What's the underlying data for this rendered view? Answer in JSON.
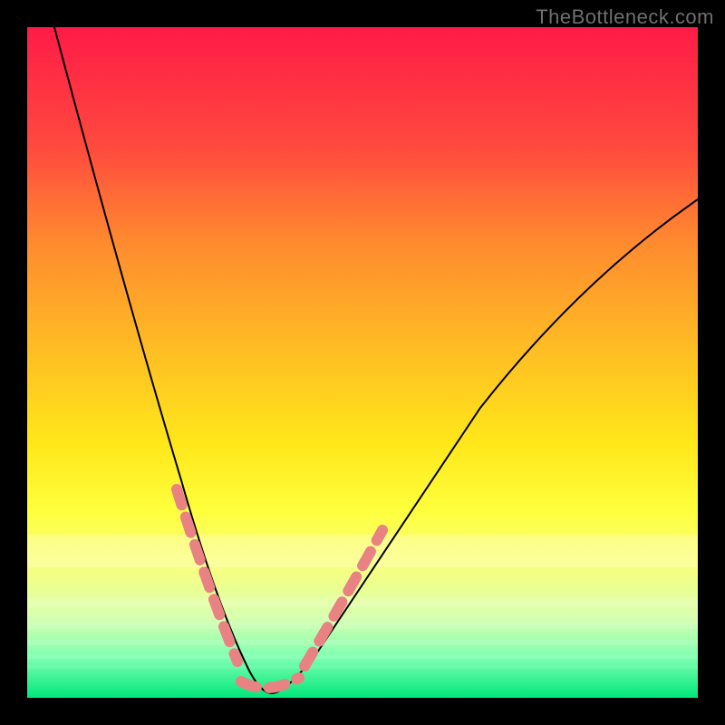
{
  "watermark": "TheBottleneck.com",
  "colors": {
    "frame_bg": "#000000",
    "gradient_top": "#ff1b47",
    "gradient_bottom": "#00e87a",
    "curve_stroke": "#000000",
    "dash_stroke": "#e98282"
  },
  "chart_data": {
    "type": "line",
    "title": "",
    "xlabel": "",
    "ylabel": "",
    "xlim": [
      0,
      100
    ],
    "ylim": [
      0,
      100
    ],
    "annotations": [
      "TheBottleneck.com"
    ],
    "series": [
      {
        "name": "bottleneck-curve",
        "x": [
          4,
          8,
          12,
          16,
          20,
          24,
          27,
          30,
          32,
          34,
          36,
          38,
          44,
          50,
          56,
          62,
          70,
          80,
          90,
          100
        ],
        "y": [
          100,
          82,
          65,
          50,
          36,
          24,
          14,
          7,
          3,
          1,
          0,
          2,
          9,
          18,
          27,
          35,
          45,
          56,
          66,
          75
        ]
      }
    ],
    "highlight_segments": [
      {
        "name": "left-dash",
        "x_range": [
          21,
          30
        ],
        "y_range": [
          27,
          5
        ]
      },
      {
        "name": "right-dash",
        "x_range": [
          38,
          50
        ],
        "y_range": [
          5,
          27
        ]
      },
      {
        "name": "bottom-dash",
        "x_range": [
          30,
          38
        ],
        "y_range": [
          0,
          0
        ]
      }
    ],
    "legend": []
  }
}
